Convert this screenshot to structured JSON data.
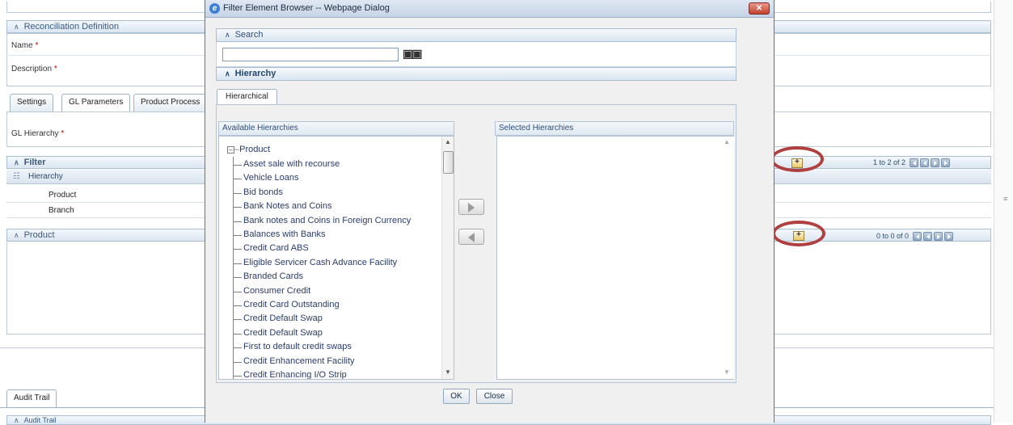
{
  "background": {
    "recon_section": "Reconciliation Definition",
    "name_label": "Name",
    "description_label": "Description",
    "required_mark": "*",
    "tabs": [
      "Settings",
      "GL Parameters",
      "Product Process"
    ],
    "gl_hierarchy_label": "GL Hierarchy",
    "filter_section": "Filter",
    "filter_column": "Hierarchy",
    "filter_rows": [
      "Product",
      "Branch"
    ],
    "filter_pager": "1 to 2 of 2",
    "product_section": "Product",
    "product_pager": "0 to 0 of 0",
    "audit_tab": "Audit Trail",
    "audit_section": "Audit Trail",
    "highlight_color": "#b04040"
  },
  "dialog": {
    "title": "Filter Element Browser -- Webpage Dialog",
    "close_glyph": "✕",
    "search_section": "Search",
    "search_value": "",
    "hierarchy_section": "Hierarchy",
    "tab_label": "Hierarchical",
    "available_header": "Available Hierarchies",
    "selected_header": "Selected Hierarchies",
    "tree_root": "Product",
    "tree_items": [
      "Asset sale with recourse",
      "Vehicle Loans",
      "Bid bonds",
      "Bank Notes and Coins",
      "Bank notes and Coins in Foreign Currency",
      "Balances with Banks",
      "Credit Card ABS",
      "Eligible Servicer Cash Advance Facility",
      "Branded Cards",
      "Consumer Credit",
      "Credit Card Outstanding",
      "Credit Default Swap",
      "Credit Default Swap",
      "First to default credit swaps",
      "Credit Enhancement Facility",
      "Credit Enhancing I/O Strip"
    ],
    "ok_label": "OK",
    "close_label": "Close",
    "scroll_glyph_up": "▲",
    "scroll_glyph_down": "▼",
    "chevron": "☆"
  }
}
